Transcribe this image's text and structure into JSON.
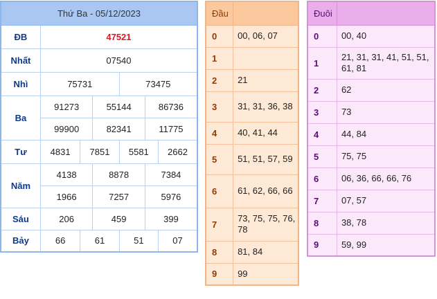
{
  "results": {
    "title": "Thứ Ba - 05/12/2023",
    "rows": {
      "db": {
        "label": "ĐB",
        "values": [
          "47521"
        ]
      },
      "nhat": {
        "label": "Nhất",
        "values": [
          "07540"
        ]
      },
      "nhi": {
        "label": "Nhì",
        "values": [
          "75731",
          "73475"
        ]
      },
      "ba": {
        "label": "Ba",
        "values": [
          "91273",
          "55144",
          "86736",
          "99900",
          "82341",
          "11775"
        ]
      },
      "tu": {
        "label": "Tư",
        "values": [
          "4831",
          "7851",
          "5581",
          "2662"
        ]
      },
      "nam": {
        "label": "Năm",
        "values": [
          "4138",
          "8878",
          "7384",
          "1966",
          "7257",
          "5976"
        ]
      },
      "sau": {
        "label": "Sáu",
        "values": [
          "206",
          "459",
          "399"
        ]
      },
      "bay": {
        "label": "Bảy",
        "values": [
          "66",
          "61",
          "51",
          "07"
        ]
      }
    }
  },
  "dau": {
    "header": "Đầu",
    "rows": [
      {
        "digit": "0",
        "values": "00, 06, 07"
      },
      {
        "digit": "1",
        "values": ""
      },
      {
        "digit": "2",
        "values": "21"
      },
      {
        "digit": "3",
        "values": "31, 31, 36, 38"
      },
      {
        "digit": "4",
        "values": "40, 41, 44"
      },
      {
        "digit": "5",
        "values": "51, 51, 57, 59"
      },
      {
        "digit": "6",
        "values": "61, 62, 66, 66"
      },
      {
        "digit": "7",
        "values": "73, 75, 75, 76, 78"
      },
      {
        "digit": "8",
        "values": "81, 84"
      },
      {
        "digit": "9",
        "values": "99"
      }
    ]
  },
  "duoi": {
    "header": "Đuôi",
    "rows": [
      {
        "digit": "0",
        "values": "00, 40"
      },
      {
        "digit": "1",
        "values": "21, 31, 31, 41, 51, 51, 61, 81"
      },
      {
        "digit": "2",
        "values": "62"
      },
      {
        "digit": "3",
        "values": "73"
      },
      {
        "digit": "4",
        "values": "44, 84"
      },
      {
        "digit": "5",
        "values": "75, 75"
      },
      {
        "digit": "6",
        "values": "06, 36, 66, 66, 76"
      },
      {
        "digit": "7",
        "values": "07, 57"
      },
      {
        "digit": "8",
        "values": "38, 78"
      },
      {
        "digit": "9",
        "values": "59, 99"
      }
    ]
  },
  "colors": {
    "special_prize": "#e0161b",
    "label_text": "#0d3a8c",
    "results_header": "#a9c7f1",
    "dau_bg": "#fde9d5",
    "duoi_bg": "#fbe9fb"
  }
}
